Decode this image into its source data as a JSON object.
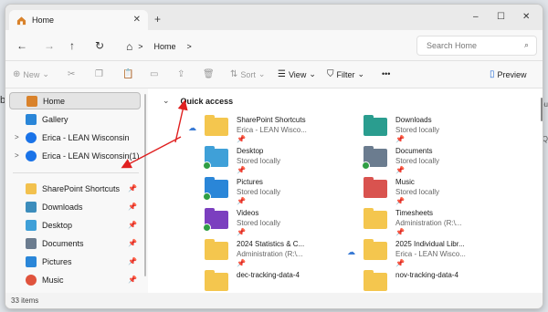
{
  "tab": {
    "title": "Home",
    "close": "✕",
    "new": "+"
  },
  "window_controls": {
    "minimize": "–",
    "maximize": "☐",
    "close": "✕"
  },
  "nav": {
    "back": "←",
    "forward": "→",
    "up": "↑",
    "refresh": "↻",
    "home_icon": "⌂",
    "sep": ">",
    "crumb": "Home",
    "crumb_sep": ">"
  },
  "search": {
    "placeholder": "Search Home",
    "icon": "⌕"
  },
  "toolbar": {
    "new_label": "New",
    "sort_label": "Sort",
    "view_label": "View",
    "filter_label": "Filter",
    "more": "•••",
    "preview_label": "Preview"
  },
  "sidebar": {
    "top": [
      {
        "label": "Home",
        "icon": "home-icon",
        "color": "#d9822b"
      },
      {
        "label": "Gallery",
        "icon": "gallery-icon",
        "color": "#2a86d8"
      },
      {
        "label": "Erica - LEAN Wisconsin",
        "icon": "cloud-icon",
        "color": "#1a73e8"
      },
      {
        "label": "Erica - LEAN Wisconsin(1)",
        "icon": "cloud-icon",
        "color": "#1a73e8"
      }
    ],
    "pinned": [
      {
        "label": "SharePoint Shortcuts",
        "icon": "folder-icon",
        "color": "#f2c14e"
      },
      {
        "label": "Downloads",
        "icon": "download-icon",
        "color": "#3c8dbc"
      },
      {
        "label": "Desktop",
        "icon": "desktop-icon",
        "color": "#3fa0d8"
      },
      {
        "label": "Documents",
        "icon": "documents-icon",
        "color": "#6b7c8f"
      },
      {
        "label": "Pictures",
        "icon": "pictures-icon",
        "color": "#2a86d8"
      },
      {
        "label": "Music",
        "icon": "music-icon",
        "color": "#e0533d"
      }
    ],
    "pin": "📌",
    "chevron": ">"
  },
  "quick_access": {
    "heading": "Quick access",
    "chevron": "⌄",
    "items": [
      {
        "name": "SharePoint Shortcuts",
        "sub": "Erica - LEAN Wisco...",
        "color": "#f4c64e",
        "cloud": true,
        "badge": false
      },
      {
        "name": "Downloads",
        "sub": "Stored locally",
        "color": "#2a9d8f",
        "cloud": false,
        "badge": false
      },
      {
        "name": "Desktop",
        "sub": "Stored locally",
        "color": "#3fa0d8",
        "cloud": false,
        "badge": true
      },
      {
        "name": "Documents",
        "sub": "Stored locally",
        "color": "#6b7c8f",
        "cloud": false,
        "badge": true
      },
      {
        "name": "Pictures",
        "sub": "Stored locally",
        "color": "#2a86d8",
        "cloud": false,
        "badge": true
      },
      {
        "name": "Music",
        "sub": "Stored locally",
        "color": "#d9534f",
        "cloud": false,
        "badge": false
      },
      {
        "name": "Videos",
        "sub": "Stored locally",
        "color": "#7b3fbf",
        "cloud": false,
        "badge": true
      },
      {
        "name": "Timesheets",
        "sub": "Administration (R:\\...",
        "color": "#f4c64e",
        "cloud": false,
        "badge": false
      },
      {
        "name": "2024 Statistics & C...",
        "sub": "Administration (R:\\...",
        "color": "#f4c64e",
        "cloud": false,
        "badge": false
      },
      {
        "name": "2025 Individual Libr...",
        "sub": "Erica - LEAN Wisco...",
        "color": "#f4c64e",
        "cloud": true,
        "badge": false
      },
      {
        "name": "dec-tracking-data-4",
        "sub": "",
        "color": "#f4c64e",
        "cloud": false,
        "badge": false
      },
      {
        "name": "nov-tracking-data-4",
        "sub": "",
        "color": "#f4c64e",
        "cloud": false,
        "badge": false
      }
    ],
    "pin": "📌",
    "cloud_icon": "☁"
  },
  "status": {
    "count": "33 items"
  },
  "background": {
    "left_letter_1": "b",
    "right_text_1": "ou",
    "right_text_2": "Q"
  },
  "colors": {
    "arrow": "#e02020",
    "selection": "#e4e4e4"
  }
}
